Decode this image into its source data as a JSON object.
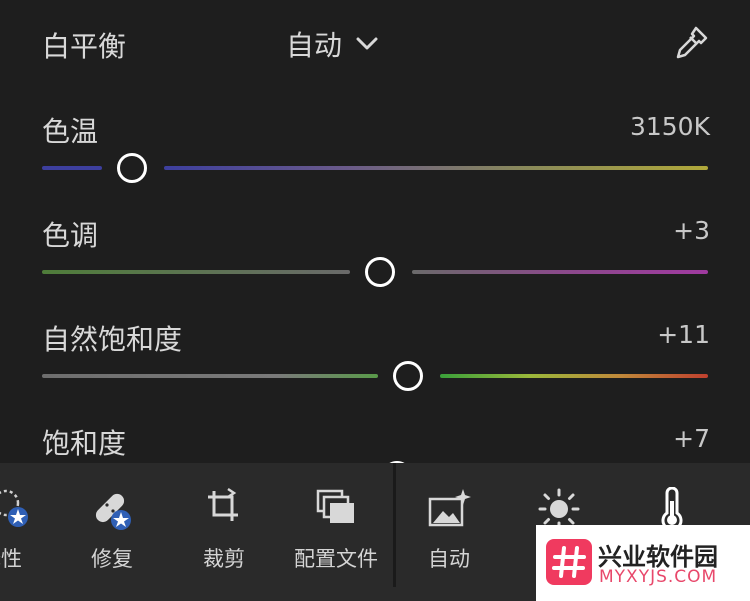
{
  "colors": {
    "background": "#1e1e1e",
    "toolbar_background": "#2a2a2a",
    "thumb_border": "#ffffff",
    "watermark_accent": "#f03a5f"
  },
  "white_balance": {
    "label": "白平衡",
    "mode_value": "自动",
    "chevron_icon": "chevron-down-icon",
    "eyedropper_icon": "eyedropper-icon"
  },
  "sliders": [
    {
      "key": "temp",
      "label": "色温",
      "value": "3150K",
      "level": 0.18
    },
    {
      "key": "tint",
      "label": "色调",
      "value": "+3",
      "level": 0.51
    },
    {
      "key": "vibrance",
      "label": "自然饱和度",
      "value": "+11",
      "level": 0.55
    },
    {
      "key": "saturation",
      "label": "饱和度",
      "value": "+7",
      "level": 0.53
    }
  ],
  "toolbar": {
    "items": [
      {
        "key": "selective",
        "label": "择性",
        "icon": "selective-edit-icon"
      },
      {
        "key": "healing",
        "label": "修复",
        "icon": "bandage-icon"
      },
      {
        "key": "crop",
        "label": "裁剪",
        "icon": "crop-icon"
      },
      {
        "key": "profiles",
        "label": "配置文件",
        "icon": "profiles-icon"
      },
      {
        "key": "auto",
        "label": "自动",
        "icon": "auto-enhance-icon"
      },
      {
        "key": "light",
        "label": "",
        "icon": "sun-icon"
      },
      {
        "key": "color",
        "label": "",
        "icon": "thermometer-icon"
      }
    ]
  },
  "watermark": {
    "logo_char": "#",
    "title": "兴业软件园",
    "url": "MYXYJS.COM"
  }
}
